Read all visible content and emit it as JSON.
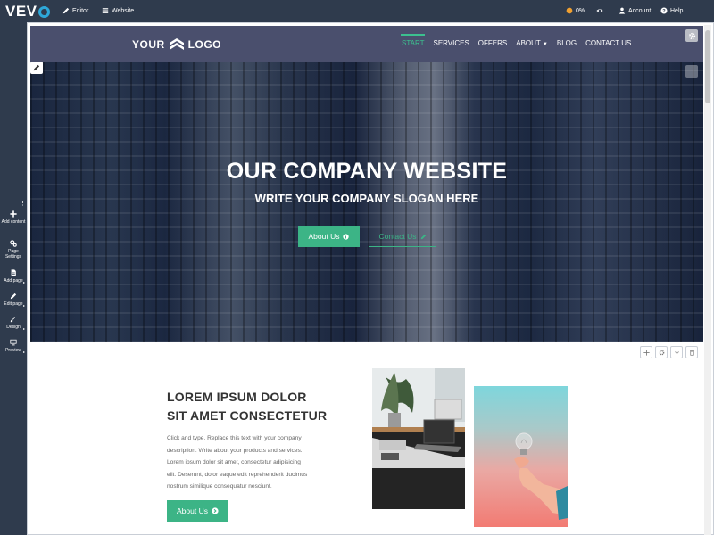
{
  "topbar": {
    "logo_text": "VEV",
    "items": [
      {
        "label": "Editor",
        "icon": "pencil-icon"
      },
      {
        "label": "Website",
        "icon": "list-icon"
      },
      {
        "label": "0%",
        "icon": "progress-icon"
      },
      {
        "label": "",
        "icon": "eye-icon"
      },
      {
        "label": "Account",
        "icon": "user-icon"
      },
      {
        "label": "Help",
        "icon": "help-icon"
      }
    ]
  },
  "sidebar": {
    "items": [
      {
        "label": "Add content",
        "icon": "plus-icon"
      },
      {
        "label": "Page Settings",
        "icon": "cogs-icon"
      },
      {
        "label": "Add page",
        "icon": "file-icon"
      },
      {
        "label": "Edit page",
        "icon": "pencil-icon"
      },
      {
        "label": "Design",
        "icon": "brush-icon"
      },
      {
        "label": "Preview",
        "icon": "monitor-icon"
      }
    ]
  },
  "site": {
    "logo_left": "YOUR",
    "logo_right": "LOGO",
    "nav": [
      "START",
      "SERVICES",
      "OFFERS",
      "ABOUT",
      "BLOG",
      "CONTACT US"
    ],
    "active_nav": "START"
  },
  "hero": {
    "title": "OUR COMPANY WEBSITE",
    "subtitle": "WRITE YOUR COMPANY SLOGAN HERE",
    "primary_button": "About Us",
    "secondary_button": "Contact Us"
  },
  "content": {
    "title_line1": "LOREM IPSUM DOLOR",
    "title_line2": "SIT AMET CONSECTETUR",
    "body_lines": [
      "Click and type. Replace this text with your company",
      "description. Write about your products and services.",
      "Lorem ipsum dolor sit amet, consectetur adipisicing",
      "elit. Deserunt, dolor eaque edit reprehenderit ducimus",
      "nostrum similique consequatur nesciunt."
    ],
    "button": "About Us"
  },
  "colors": {
    "accent": "#3cb486",
    "nav_bg": "#4a4f6d",
    "editor_bg": "#2f3b4d"
  }
}
